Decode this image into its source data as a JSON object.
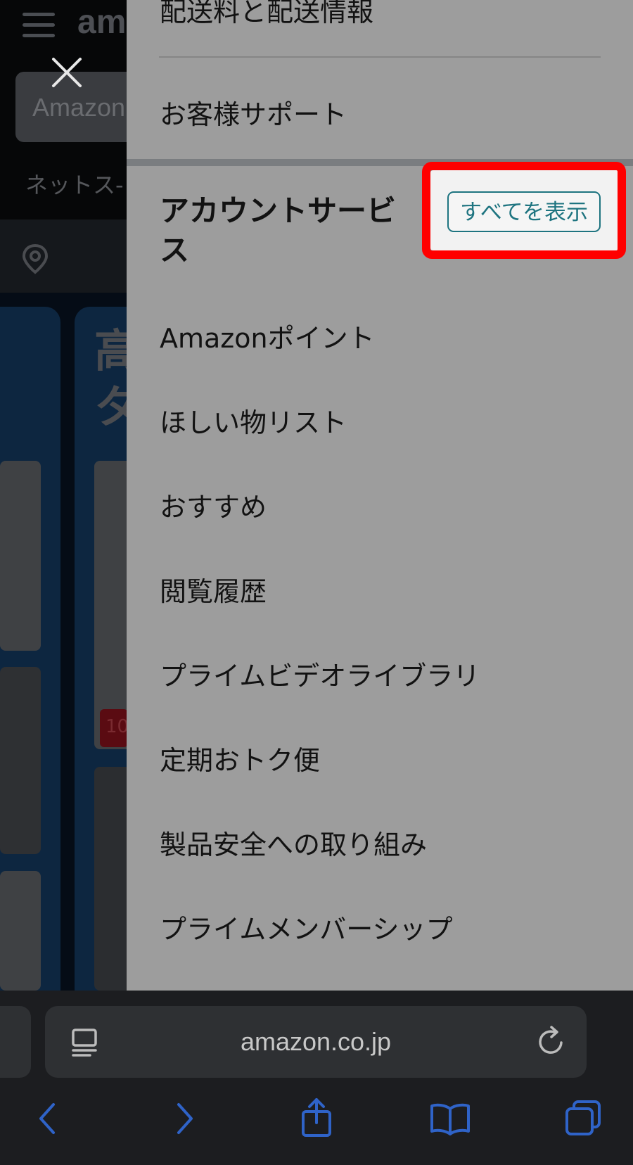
{
  "background": {
    "logo_text": "am",
    "search_placeholder": "Amazon",
    "subtitle": "ネットス-",
    "promo_text": "高\nタ",
    "tag_text": "10"
  },
  "drawer": {
    "shipping_label": "配送料と配送情報",
    "support_label": "お客様サポート",
    "section_title": "アカウントサービス",
    "see_all_label": "すべてを表示",
    "items": [
      {
        "label": "Amazonポイント"
      },
      {
        "label": "ほしい物リスト"
      },
      {
        "label": "おすすめ"
      },
      {
        "label": "閲覧履歴"
      },
      {
        "label": "プライムビデオライブラリ"
      },
      {
        "label": "定期おトク便"
      },
      {
        "label": "製品安全への取り組み"
      },
      {
        "label": "プライムメンバーシップ"
      }
    ]
  },
  "browser": {
    "url": "amazon.co.jp"
  },
  "colors": {
    "drawer_bg": "#9d9d9d",
    "highlight": "#ff0000",
    "link_teal": "#1e7480",
    "toolbar_icon": "#2f63c8"
  }
}
